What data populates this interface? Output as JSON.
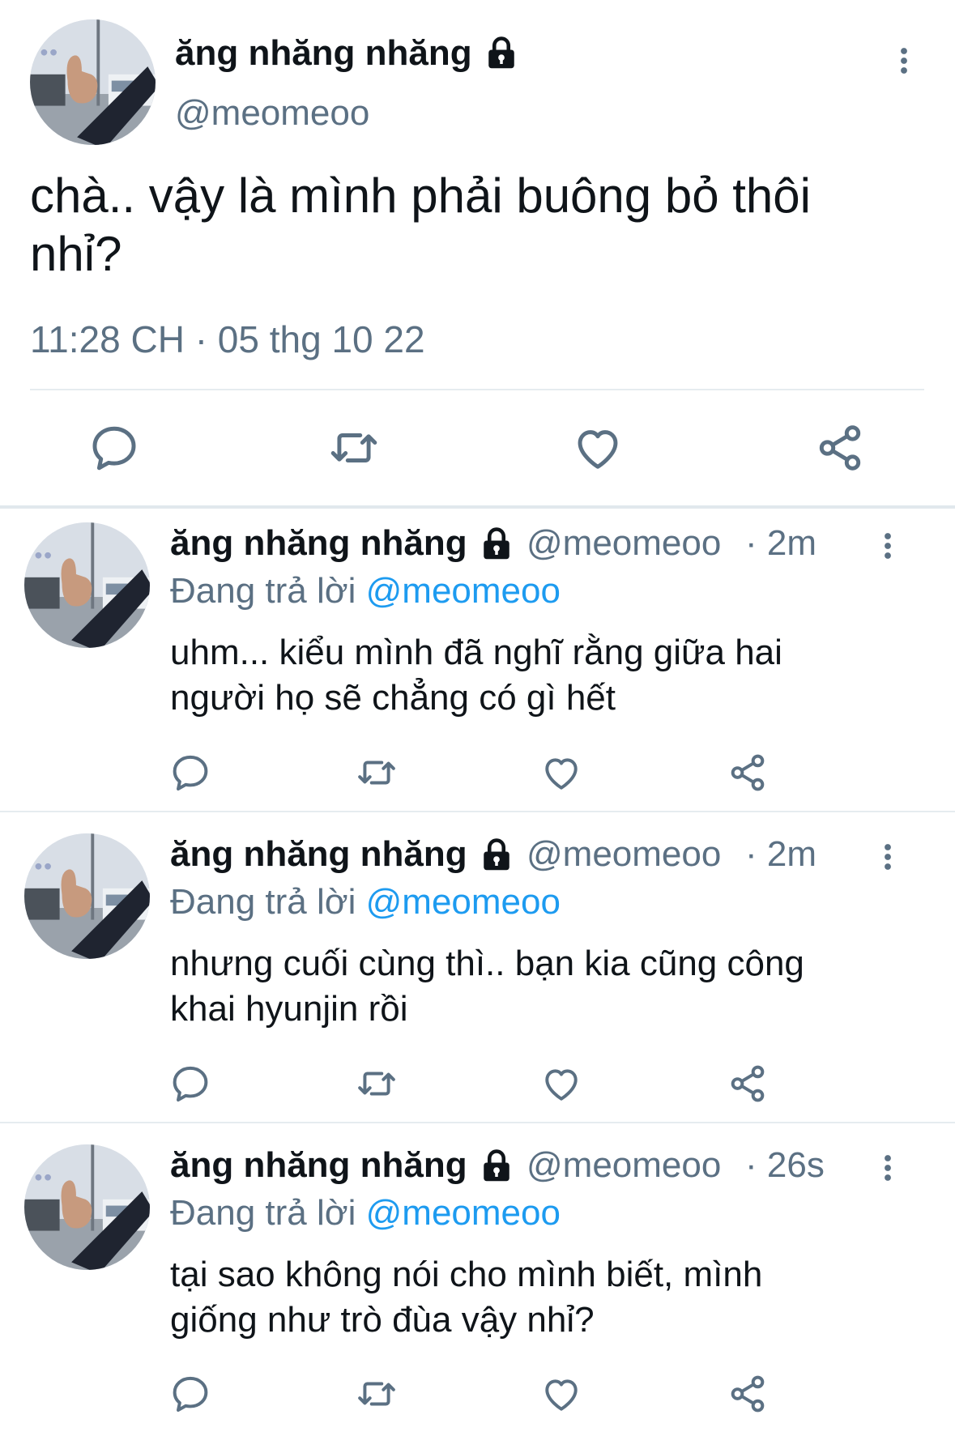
{
  "main_tweet": {
    "display_name": "ăng nhăng nhăng",
    "handle": "@meomeoo",
    "text_line1": "chà.. vậy là mình phải buông bỏ thôi",
    "text_line2": "nhỉ?",
    "timestamp": "11:28 CH · 05 thg 10 22"
  },
  "replies": [
    {
      "display_name": "ăng nhăng nhăng",
      "handle": "@meomeoo",
      "age": "· 2m",
      "reply_prefix": "Đang trả lời",
      "reply_mention": "@meomeoo",
      "text_line1": "uhm... kiểu mình đã nghĩ rằng giữa hai",
      "text_line2": "người họ sẽ chẳng có gì hết"
    },
    {
      "display_name": "ăng nhăng nhăng",
      "handle": "@meomeoo",
      "age": "· 2m",
      "reply_prefix": "Đang trả lời",
      "reply_mention": "@meomeoo",
      "text_line1": "nhưng cuối cùng thì.. bạn kia cũng công",
      "text_line2": "khai hyunjin rồi"
    },
    {
      "display_name": "ăng nhăng nhăng",
      "handle": "@meomeoo",
      "age": "· 26s",
      "reply_prefix": "Đang trả lời",
      "reply_mention": "@meomeoo",
      "text_line1": "tại sao không nói cho mình biết, mình",
      "text_line2": "giống như trò đùa vậy nhỉ?"
    }
  ],
  "icons": {
    "lock": "lock-icon",
    "more": "more-vertical-icon",
    "reply": "reply-icon",
    "retweet": "retweet-icon",
    "like": "like-icon",
    "share": "share-icon"
  },
  "colors": {
    "text": "#0f1419",
    "secondary": "#5b7083",
    "mention": "#1d9bf0",
    "divider": "#e6ecf0"
  }
}
